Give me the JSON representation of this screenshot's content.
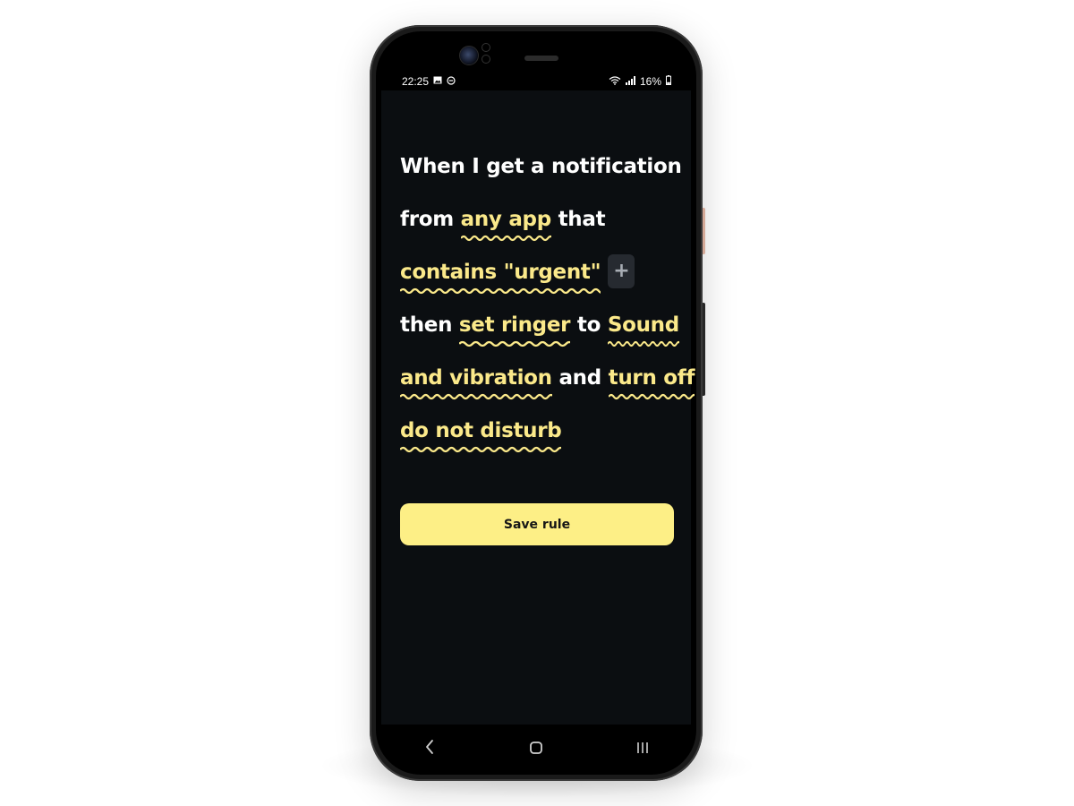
{
  "status_bar": {
    "time": "22:25",
    "left_icons": [
      "gallery-icon",
      "dnd-icon"
    ],
    "right_icons": [
      "wifi-icon",
      "signal-icon",
      "battery-icon"
    ],
    "battery_percent": "16%"
  },
  "rule": {
    "line1": {
      "text": "When I get a notification"
    },
    "line2": {
      "pre": "from",
      "token": "any app",
      "post": "that"
    },
    "line3": {
      "token": "contains \"urgent\"",
      "add_label": "+"
    },
    "line4": {
      "pre": "then",
      "token1": "set ringer",
      "mid": "to",
      "token2": "Sound"
    },
    "line5": {
      "token1": "and vibration",
      "mid": "and",
      "token2": "turn off"
    },
    "line6": {
      "token": "do not disturb"
    }
  },
  "save_button": {
    "label": "Save rule"
  },
  "nav_bar": {
    "back_icon": "chevron-left-icon",
    "home_icon": "home-square-icon",
    "recents_icon": "recents-bars-icon"
  },
  "colors": {
    "screen_bg": "#0b0e11",
    "token": "#fbe98a",
    "button_bg": "#fdef86",
    "text": "#ffffff"
  }
}
